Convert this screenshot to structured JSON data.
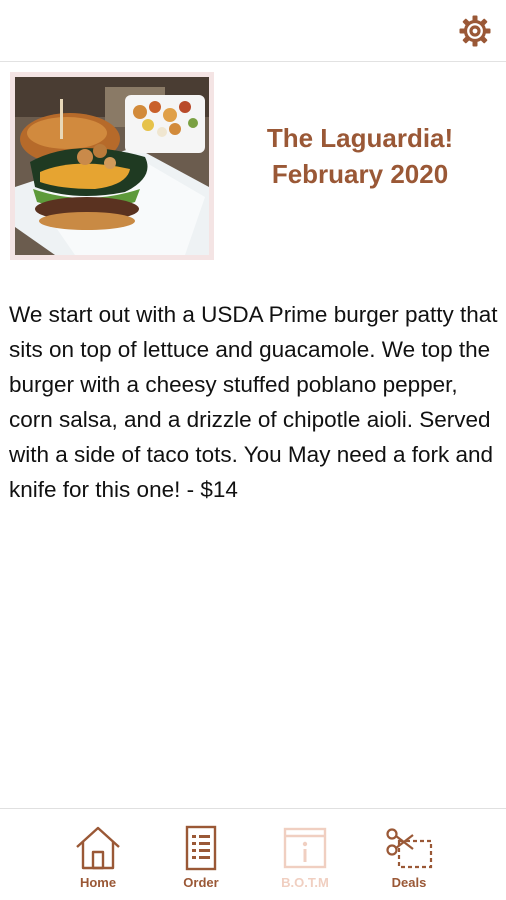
{
  "header": {
    "settings_icon": "gear-icon"
  },
  "feature": {
    "image_alt": "burger-with-taco-tots-photo",
    "title_line1": "The Laguardia!",
    "title_line2": "February 2020",
    "description": "We start out with a USDA Prime burger patty that sits on top of lettuce and guacamole. We top the burger with a cheesy stuffed poblano pepper, corn salsa, and a drizzle of chipotle aioli. Served with a side of taco tots. You May need a fork and knife for this one! - $14"
  },
  "tabbar": {
    "items": [
      {
        "label": "Home",
        "icon": "house-icon",
        "active": false
      },
      {
        "label": "Order",
        "icon": "menu-list-icon",
        "active": false
      },
      {
        "label": "B.O.T.M",
        "icon": "info-board-icon",
        "active": true
      },
      {
        "label": "Deals",
        "icon": "coupon-scissors-icon",
        "active": false
      }
    ]
  },
  "colors": {
    "accent": "#9a5836",
    "accent_inactive_tab": "#f0cfc1",
    "text": "#111111",
    "divider": "#e2e2e2"
  }
}
